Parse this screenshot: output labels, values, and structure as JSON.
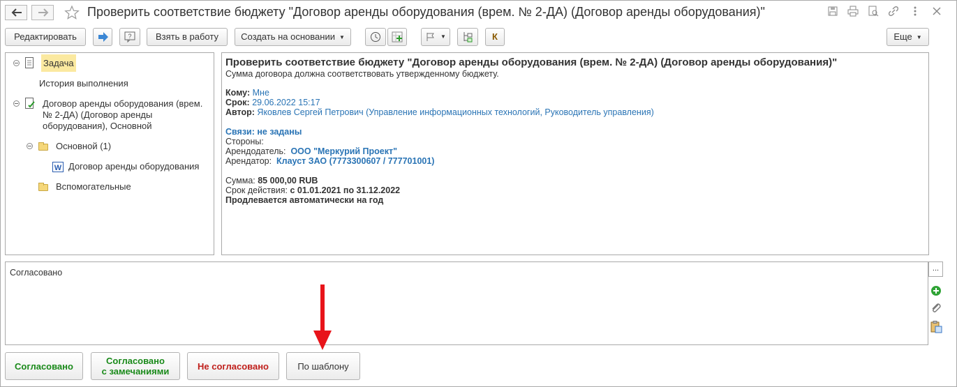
{
  "window": {
    "title": "Проверить соответствие бюджету \"Договор аренды оборудования (врем. № 2-ДА) (Договор аренды оборудования)\""
  },
  "toolbar": {
    "edit_label": "Редактировать",
    "take_label": "Взять в работу",
    "create_label": "Создать на основании",
    "k_label": "К",
    "more_label": "Еще"
  },
  "tree": {
    "task_label": "Задача",
    "history_label": "История выполнения",
    "contract_label_1": "Договор аренды оборудования (врем.",
    "contract_label_2": "№ 2-ДА) (Договор аренды",
    "contract_label_3": "оборудования), Основной",
    "main_folder_label": "Основной (1)",
    "file_label": "Договор аренды оборудования",
    "aux_folder_label": "Вспомогательные"
  },
  "details": {
    "title": "Проверить соответствие бюджету \"Договор аренды оборудования (врем. № 2-ДА) (Договор аренды оборудования)\"",
    "description": "Сумма договора должна соответствовать утвержденному бюджету.",
    "to_label": "Кому:",
    "to_value": "Мне",
    "due_label": "Срок:",
    "due_value": "29.06.2022 15:17",
    "author_label": "Автор:",
    "author_value": "Яковлев Сергей Петрович (Управление информационных технологий, Руководитель управления)",
    "links_label": "Связи: не заданы",
    "parties_label": "Стороны:",
    "lessor_label": "Арендодатель:",
    "lessor_value": "ООО \"Меркурий Проект\"",
    "lessee_label": "Арендатор:",
    "lessee_value": "Клауст ЗАО (7773300607 / 777701001)",
    "sum_label": "Сумма:",
    "sum_value": "85 000,00 RUB",
    "period_label": "Срок действия:",
    "period_value": "с 01.01.2021 по 31.12.2022",
    "renewal": "Продлевается автоматически на год"
  },
  "comment": {
    "text": "Согласовано",
    "more_label": "..."
  },
  "actions": {
    "approve_label": "Согласовано",
    "approve_remarks_1": "Согласовано",
    "approve_remarks_2": "с замечаниями",
    "reject_label": "Не согласовано",
    "template_label": "По шаблону"
  },
  "colors": {
    "approve": "#1a8a1a",
    "reject": "#c0201c",
    "link": "#2a74b5",
    "arrow": "#e8141a",
    "task_highlight": "#fbe9a0"
  }
}
